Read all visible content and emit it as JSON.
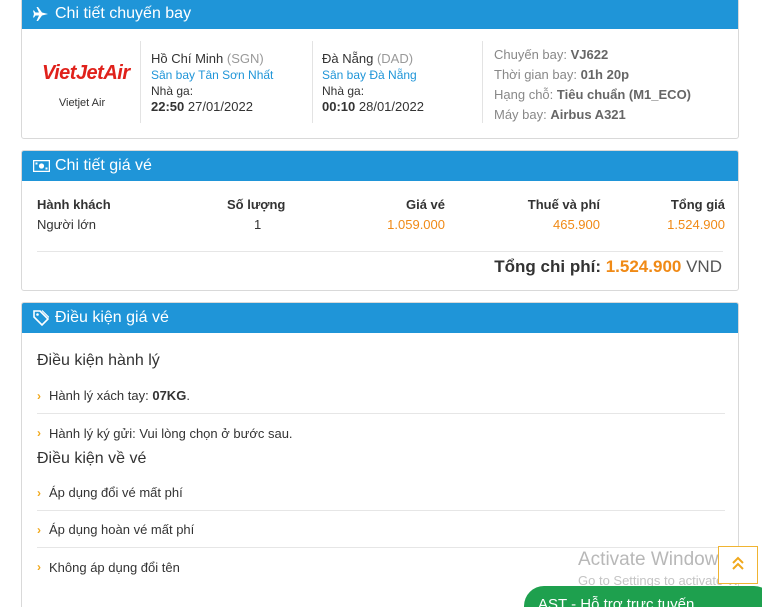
{
  "flight_panel": {
    "title": "Chi tiết chuyến bay",
    "airline_logo": "VietJetAir",
    "airline_name": "Vietjet Air",
    "departure": {
      "city": "Hồ Chí Minh",
      "code": "(SGN)",
      "airport": "Sân bay Tân Sơn Nhất",
      "terminal_label": "Nhà ga:",
      "time": "22:50",
      "date": "27/01/2022"
    },
    "arrival": {
      "city": "Đà Nẵng",
      "code": "(DAD)",
      "airport": "Sân bay Đà Nẵng",
      "terminal_label": "Nhà ga:",
      "time": "00:10",
      "date": "28/01/2022"
    },
    "info": {
      "flight_label": "Chuyến bay:",
      "flight_value": "VJ622",
      "duration_label": "Thời gian bay:",
      "duration_value": "01h 20p",
      "class_label": "Hạng chỗ:",
      "class_value": "Tiêu chuẩn (M1_ECO)",
      "aircraft_label": "Máy bay:",
      "aircraft_value": "Airbus A321"
    }
  },
  "price_panel": {
    "title": "Chi tiết giá vé",
    "headers": {
      "passenger": "Hành khách",
      "quantity": "Số lượng",
      "fare": "Giá vé",
      "tax": "Thuế và phí",
      "total": "Tổng giá"
    },
    "rows": [
      {
        "passenger": "Người lớn",
        "quantity": "1",
        "fare": "1.059.000",
        "tax": "465.900",
        "total": "1.524.900"
      }
    ],
    "grand_total_label": "Tổng chi phí:",
    "grand_total_value": "1.524.900",
    "currency": "VND"
  },
  "conditions_panel": {
    "title": "Điều kiện giá vé",
    "baggage_title": "Điều kiện hành lý",
    "baggage": {
      "carry_on_label": "Hành lý xách tay:",
      "carry_on_value": "07KG",
      "checked_text": "Hành lý ký gửi: Vui lòng chọn ở bước sau."
    },
    "ticket_title": "Điều kiện về vé",
    "ticket_items": [
      "Áp dụng đổi vé mất phí",
      "Áp dụng hoàn vé mất phí",
      "Không áp dụng đổi tên"
    ]
  },
  "overlay": {
    "watermark_line1": "Activate Windows",
    "watermark_line2": "Go to Settings to activate W",
    "support_label": "AST - Hỗ trợ trực tuyến"
  },
  "colors": {
    "header_blue": "#1f95d8",
    "price_orange": "#f08a16",
    "brand_red": "#e0211b",
    "support_green": "#1ea04e"
  }
}
